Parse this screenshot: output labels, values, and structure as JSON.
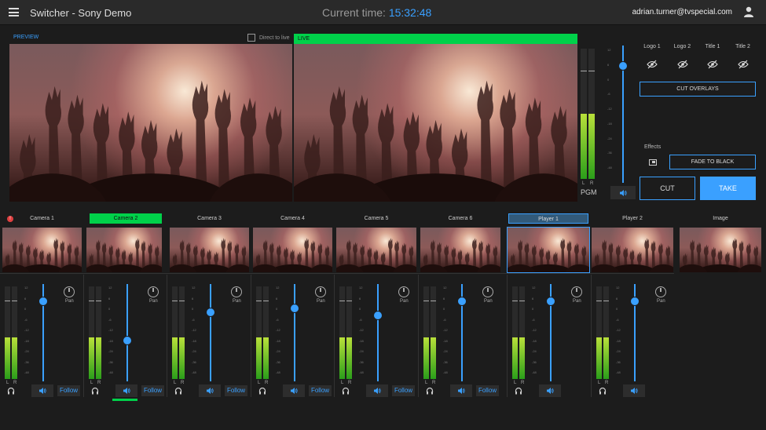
{
  "app": {
    "title": "Switcher - Sony Demo",
    "user_email": "adrian.turner@tvspecial.com"
  },
  "clock": {
    "label": "Current time:",
    "value": "15:32:48"
  },
  "monitors": {
    "preview_label": "PREVIEW",
    "direct_to_live_label": "Direct to live",
    "direct_to_live_checked": false,
    "live_label": "LIVE"
  },
  "program_audio": {
    "label": "PGM",
    "left": "L",
    "right": "R",
    "fader_level": 0.85,
    "meter_level": 0.5
  },
  "overlays": {
    "items": [
      {
        "label": "Logo 1"
      },
      {
        "label": "Logo 2"
      },
      {
        "label": "Title 1"
      },
      {
        "label": "Title 2"
      }
    ],
    "cut_label": "CUT OVERLAYS"
  },
  "effects": {
    "label": "Effects",
    "fade_label": "FADE TO BLACK"
  },
  "transition": {
    "cut_label": "CUT",
    "take_label": "TAKE"
  },
  "sources": [
    {
      "label": "Camera 1",
      "state": "alert"
    },
    {
      "label": "Camera 2",
      "state": "preview"
    },
    {
      "label": "Camera 3",
      "state": ""
    },
    {
      "label": "Camera 4",
      "state": ""
    },
    {
      "label": "Camera 5",
      "state": ""
    },
    {
      "label": "Camera 6",
      "state": ""
    },
    {
      "label": "Player 1",
      "state": "selected"
    },
    {
      "label": "Player 2",
      "state": ""
    },
    {
      "label": "Image",
      "state": ""
    }
  ],
  "alert_symbol": "!",
  "channels": [
    {
      "fader": 0.82,
      "follow_label": "Follow",
      "pan_label": "Pan",
      "left": "L",
      "right": "R"
    },
    {
      "fader": 0.42,
      "follow_label": "Follow",
      "pan_label": "Pan",
      "left": "L",
      "right": "R"
    },
    {
      "fader": 0.71,
      "follow_label": "Follow",
      "pan_label": "Pan",
      "left": "L",
      "right": "R"
    },
    {
      "fader": 0.75,
      "follow_label": "Follow",
      "pan_label": "Pan",
      "left": "L",
      "right": "R"
    },
    {
      "fader": 0.68,
      "follow_label": "Follow",
      "pan_label": "Pan",
      "left": "L",
      "right": "R"
    },
    {
      "fader": 0.82,
      "follow_label": "Follow",
      "pan_label": "Pan",
      "left": "L",
      "right": "R"
    },
    {
      "fader": 0.82,
      "follow_label": "",
      "pan_label": "Pan",
      "left": "L",
      "right": "R"
    },
    {
      "fader": 0.82,
      "follow_label": "",
      "pan_label": "Pan",
      "left": "L",
      "right": "R"
    }
  ],
  "scale_marks": [
    "12",
    "6",
    "0",
    "-6",
    "-12",
    "-18",
    "-24",
    "-36",
    "-48"
  ],
  "colors": {
    "accent": "#3aa0ff",
    "live": "#00d14a",
    "background": "#1c1c1c",
    "alert": "#e04040"
  },
  "icons": [
    "hamburger-menu-icon",
    "user-icon",
    "eye-off-icon",
    "speaker-icon",
    "headphones-icon",
    "pan-knob-icon",
    "picture-in-picture-icon"
  ]
}
